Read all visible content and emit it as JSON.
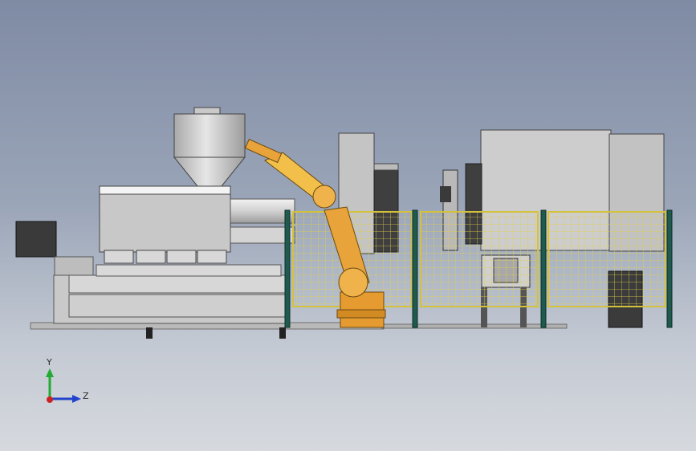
{
  "viewport": {
    "background_top": "#7f8ba4",
    "background_bottom": "#d6d9de"
  },
  "model": {
    "components": [
      "injection-molding-machine",
      "hopper",
      "industrial-robot-arm",
      "safety-fence",
      "control-cabinet",
      "tool-stand",
      "caster-wheel"
    ],
    "colors": {
      "machine_body": "#c9c9c9",
      "robot": "#e8a33a",
      "fence_post": "#1f5a4e",
      "fence_mesh": "#e6d24a"
    }
  },
  "triad": {
    "y_label": "Y",
    "z_label": "Z",
    "y_color": "#22aa33",
    "z_color": "#2244cc",
    "x_color": "#cc2222"
  }
}
